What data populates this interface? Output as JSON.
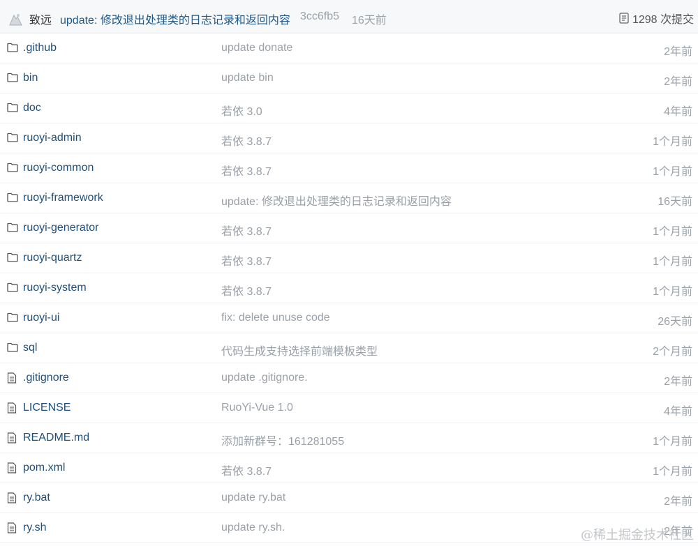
{
  "commit": {
    "author": "致远",
    "message": "update: 修改退出处理类的日志记录和返回内容",
    "sha": "3cc6fb5",
    "time": "16天前",
    "count": "1298 次提交"
  },
  "files": [
    {
      "type": "folder",
      "name": ".github",
      "message": "update donate",
      "time": "2年前"
    },
    {
      "type": "folder",
      "name": "bin",
      "message": "update bin",
      "time": "2年前"
    },
    {
      "type": "folder",
      "name": "doc",
      "message": "若依 3.0",
      "time": "4年前"
    },
    {
      "type": "folder",
      "name": "ruoyi-admin",
      "message": "若依 3.8.7",
      "time": "1个月前"
    },
    {
      "type": "folder",
      "name": "ruoyi-common",
      "message": "若依 3.8.7",
      "time": "1个月前"
    },
    {
      "type": "folder",
      "name": "ruoyi-framework",
      "message": "update: 修改退出处理类的日志记录和返回内容",
      "time": "16天前"
    },
    {
      "type": "folder",
      "name": "ruoyi-generator",
      "message": "若依 3.8.7",
      "time": "1个月前"
    },
    {
      "type": "folder",
      "name": "ruoyi-quartz",
      "message": "若依 3.8.7",
      "time": "1个月前"
    },
    {
      "type": "folder",
      "name": "ruoyi-system",
      "message": "若依 3.8.7",
      "time": "1个月前"
    },
    {
      "type": "folder",
      "name": "ruoyi-ui",
      "message": "fix: delete unuse code",
      "time": "26天前"
    },
    {
      "type": "folder",
      "name": "sql",
      "message": "代码生成支持选择前端模板类型",
      "time": "2个月前"
    },
    {
      "type": "file",
      "name": ".gitignore",
      "message": "update .gitignore.",
      "time": "2年前"
    },
    {
      "type": "file",
      "name": "LICENSE",
      "message": "RuoYi-Vue 1.0",
      "time": "4年前"
    },
    {
      "type": "file",
      "name": "README.md",
      "message": "添加新群号：161281055",
      "time": "1个月前"
    },
    {
      "type": "file",
      "name": "pom.xml",
      "message": "若依 3.8.7",
      "time": "1个月前"
    },
    {
      "type": "file",
      "name": "ry.bat",
      "message": "update ry.bat",
      "time": "2年前"
    },
    {
      "type": "file",
      "name": "ry.sh",
      "message": "update ry.sh.",
      "time": "2年前"
    }
  ],
  "watermark": "@稀土掘金技术社区"
}
